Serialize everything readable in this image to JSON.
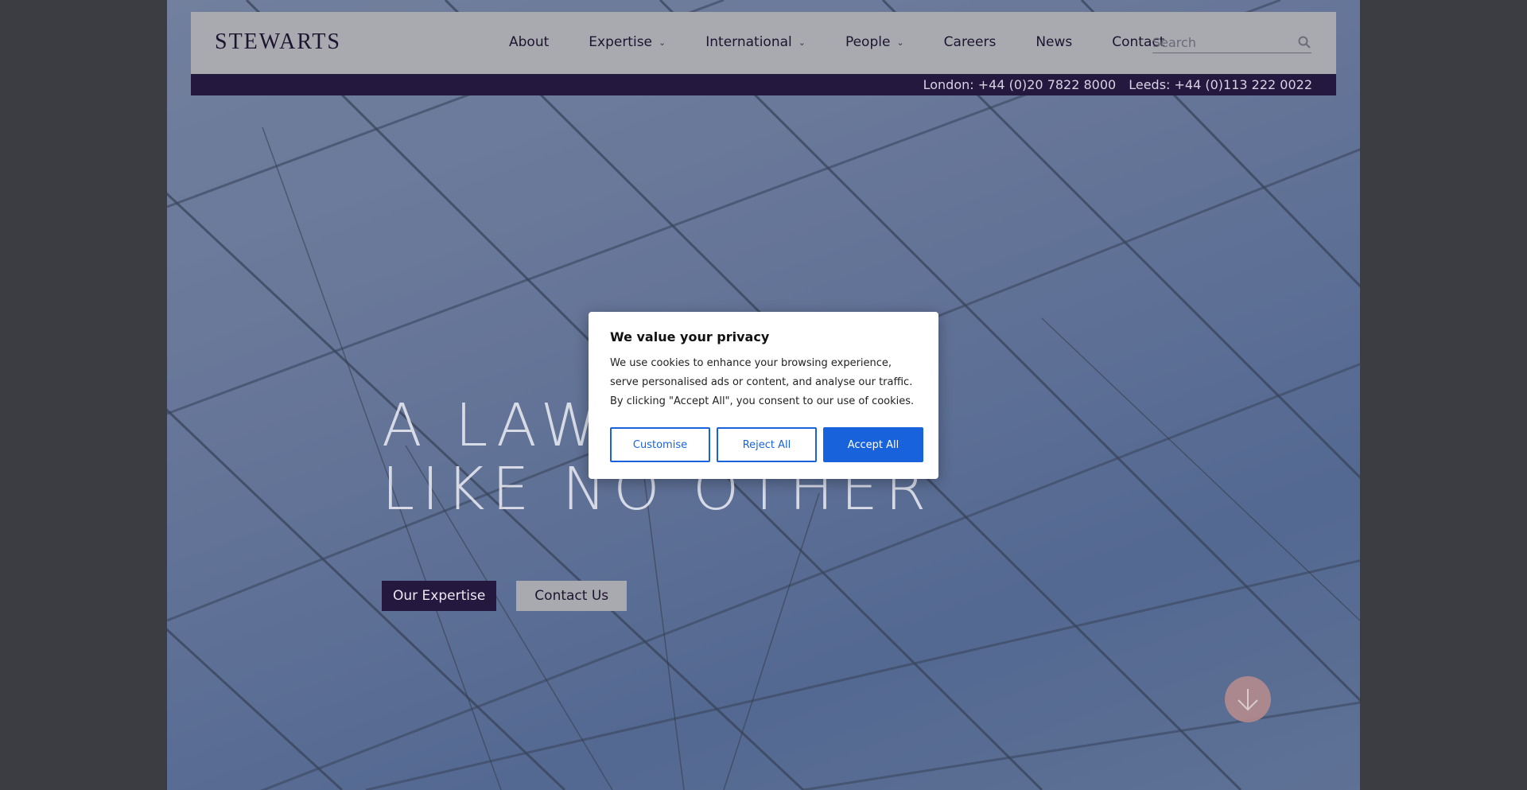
{
  "brand": {
    "logo_text": "STEWARTS"
  },
  "nav": {
    "items": [
      {
        "label": "About",
        "has_dropdown": false
      },
      {
        "label": "Expertise",
        "has_dropdown": true
      },
      {
        "label": "International",
        "has_dropdown": true
      },
      {
        "label": "People",
        "has_dropdown": true
      },
      {
        "label": "Careers",
        "has_dropdown": false
      },
      {
        "label": "News",
        "has_dropdown": false
      },
      {
        "label": "Contact",
        "has_dropdown": false
      }
    ]
  },
  "search": {
    "placeholder": "Search",
    "icon": "search-icon"
  },
  "contact_bar": {
    "london": "London: +44 (0)20 7822 8000",
    "leeds": "Leeds: +44 (0)113 222 0022"
  },
  "hero": {
    "line1": "A LAW",
    "line2": "LIKE NO OTHER",
    "btn_expertise": "Our Expertise",
    "btn_contact": "Contact Us",
    "scroll_icon": "arrow-down-icon"
  },
  "cookie": {
    "title": "We value your privacy",
    "text": "We use cookies to enhance your browsing experience, serve personalised ads or content, and analyse our traffic. By clicking \"Accept All\", you consent to our use of cookies.",
    "customise": "Customise",
    "reject": "Reject All",
    "accept": "Accept All"
  },
  "colors": {
    "brand_purple": "#25183f",
    "header_grey": "#a9aab0",
    "cookie_blue": "#1863dc",
    "scroll_button": "#b48b8d"
  }
}
